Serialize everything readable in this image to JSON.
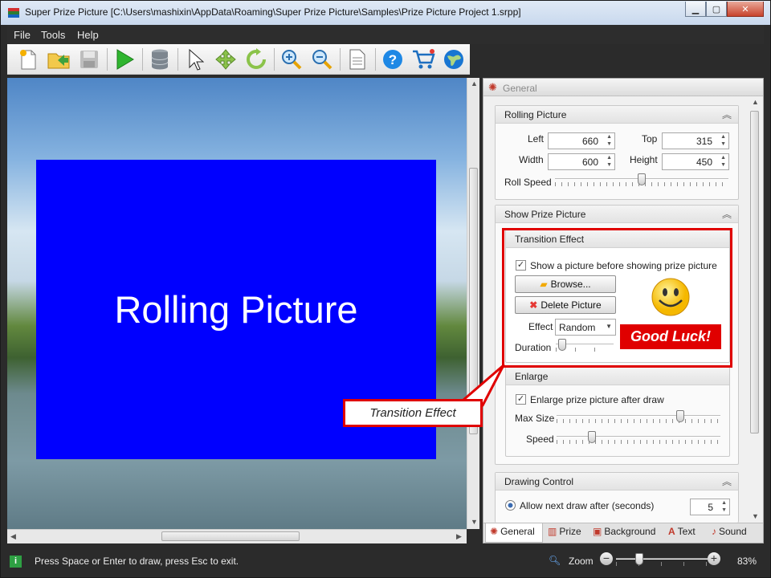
{
  "window": {
    "title": "Super Prize Picture [C:\\Users\\mashixin\\AppData\\Roaming\\Super Prize Picture\\Samples\\Prize Picture Project 1.srpp]",
    "minimize": "▁",
    "maximize": "▢",
    "close": "✕"
  },
  "menu": [
    "File",
    "Tools",
    "Help"
  ],
  "toolbar": {
    "icons": [
      "new-icon",
      "open-icon",
      "save-icon",
      "play-icon",
      "database-icon",
      "pointer-icon",
      "move-icon",
      "rotate-icon",
      "zoom-in-icon",
      "zoom-out-icon",
      "page-icon",
      "help-icon",
      "cart-icon",
      "globe-icon"
    ]
  },
  "canvas": {
    "rolling_text": "Rolling Picture"
  },
  "callout": {
    "label": "Transition Effect"
  },
  "panel": {
    "header": "General",
    "rolling": {
      "title": "Rolling Picture",
      "left_label": "Left",
      "left_value": "660",
      "top_label": "Top",
      "top_value": "315",
      "width_label": "Width",
      "width_value": "600",
      "height_label": "Height",
      "height_value": "450",
      "speed_label": "Roll Speed",
      "speed_fraction": 0.5
    },
    "show_prize": {
      "title": "Show Prize Picture",
      "transition": {
        "title": "Transition Effect",
        "checkbox_label": "Show a picture before showing prize picture",
        "browse_label": "Browse...",
        "delete_label": "Delete Picture",
        "effect_label": "Effect",
        "effect_value": "Random",
        "duration_label": "Duration",
        "duration_fraction": 0.05,
        "preview_text": "Good Luck!"
      },
      "enlarge": {
        "title": "Enlarge",
        "checkbox_label": "Enlarge prize picture after draw",
        "maxsize_label": "Max Size",
        "maxsize_fraction": 0.77,
        "speed_label": "Speed",
        "speed_fraction": 0.2
      }
    },
    "drawing": {
      "title": "Drawing Control",
      "radio_label": "Allow next draw after (seconds)",
      "seconds_value": "5"
    },
    "tabs": [
      "General",
      "Prize",
      "Background",
      "Text",
      "Sound"
    ]
  },
  "status": {
    "message": "Press Space or Enter to draw, press Esc to exit.",
    "zoom_label": "Zoom",
    "zoom_value": "83%",
    "zoom_fraction": 0.23
  },
  "colors": {
    "rolling_bg": "#0000ff",
    "highlight": "#e00000",
    "good_luck_bg": "#e00000"
  }
}
